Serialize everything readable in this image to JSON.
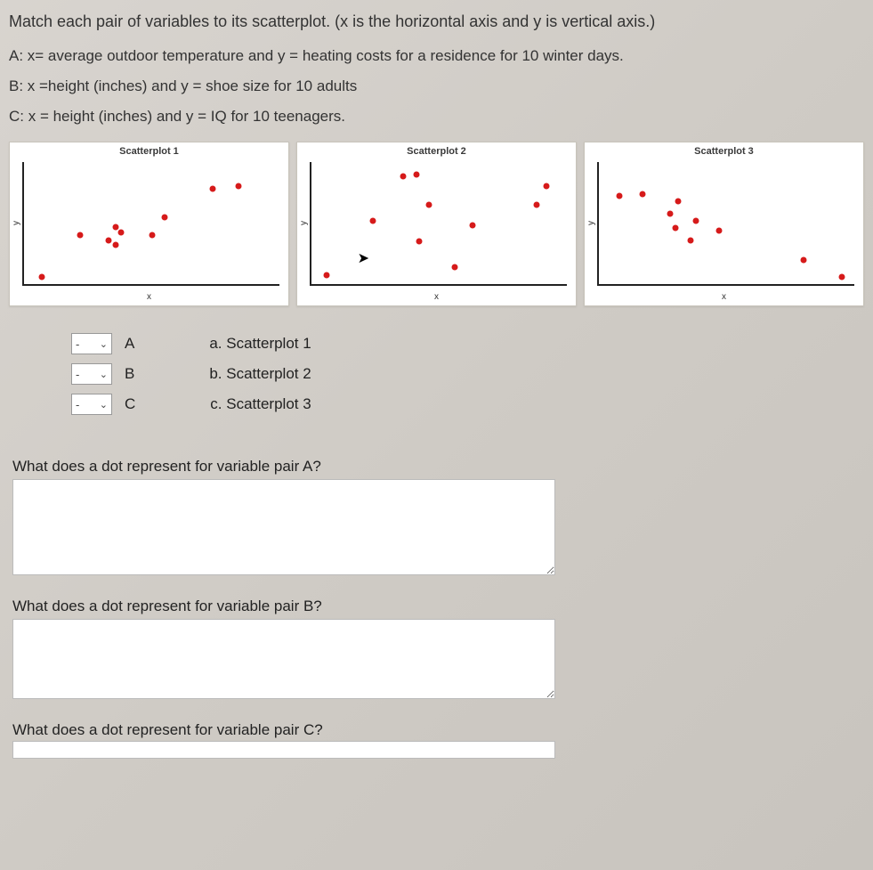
{
  "instruction": "Match each pair of variables to its scatterplot. (x is the horizontal axis and y is vertical axis.)",
  "options": {
    "A": "A: x= average outdoor temperature and y = heating costs for a residence for 10 winter days.",
    "B": "B: x =height (inches) and y = shoe size for 10 adults",
    "C": "C: x = height (inches) and y = IQ for 10 teenagers."
  },
  "plots": {
    "sp1": {
      "title": "Scatterplot 1",
      "x": "x",
      "y": "y"
    },
    "sp2": {
      "title": "Scatterplot 2",
      "x": "x",
      "y": "y"
    },
    "sp3": {
      "title": "Scatterplot 3",
      "x": "x",
      "y": "y"
    }
  },
  "chart_data": [
    {
      "type": "scatter",
      "title": "Scatterplot 1",
      "xlabel": "x",
      "ylabel": "y",
      "xlim": [
        0,
        100
      ],
      "ylim": [
        0,
        100
      ],
      "points": [
        {
          "x": 7,
          "y": 6
        },
        {
          "x": 22,
          "y": 40
        },
        {
          "x": 33,
          "y": 36
        },
        {
          "x": 36,
          "y": 32
        },
        {
          "x": 38,
          "y": 42
        },
        {
          "x": 36,
          "y": 47
        },
        {
          "x": 50,
          "y": 40
        },
        {
          "x": 55,
          "y": 55
        },
        {
          "x": 74,
          "y": 78
        },
        {
          "x": 84,
          "y": 80
        }
      ]
    },
    {
      "type": "scatter",
      "title": "Scatterplot 2",
      "xlabel": "x",
      "ylabel": "y",
      "xlim": [
        0,
        100
      ],
      "ylim": [
        0,
        100
      ],
      "points": [
        {
          "x": 6,
          "y": 7
        },
        {
          "x": 24,
          "y": 52
        },
        {
          "x": 36,
          "y": 88
        },
        {
          "x": 41,
          "y": 90
        },
        {
          "x": 42,
          "y": 35
        },
        {
          "x": 46,
          "y": 65
        },
        {
          "x": 56,
          "y": 14
        },
        {
          "x": 63,
          "y": 48
        },
        {
          "x": 88,
          "y": 65
        },
        {
          "x": 92,
          "y": 80
        }
      ]
    },
    {
      "type": "scatter",
      "title": "Scatterplot 3",
      "xlabel": "x",
      "ylabel": "y",
      "xlim": [
        0,
        100
      ],
      "ylim": [
        0,
        100
      ],
      "points": [
        {
          "x": 8,
          "y": 72
        },
        {
          "x": 17,
          "y": 74
        },
        {
          "x": 28,
          "y": 58
        },
        {
          "x": 30,
          "y": 46
        },
        {
          "x": 31,
          "y": 68
        },
        {
          "x": 36,
          "y": 36
        },
        {
          "x": 38,
          "y": 52
        },
        {
          "x": 47,
          "y": 44
        },
        {
          "x": 80,
          "y": 20
        },
        {
          "x": 95,
          "y": 6
        }
      ]
    }
  ],
  "match": {
    "select_placeholder": "-",
    "rows": [
      {
        "letter": "A",
        "answer": "a. Scatterplot 1"
      },
      {
        "letter": "B",
        "answer": "b. Scatterplot 2"
      },
      {
        "letter": "C",
        "answer": "c. Scatterplot 3"
      }
    ]
  },
  "questions": {
    "qA": "What does a dot represent for variable pair A?",
    "qB": "What does a dot represent for variable pair B?",
    "qC": "What does a dot represent for variable pair C?"
  }
}
